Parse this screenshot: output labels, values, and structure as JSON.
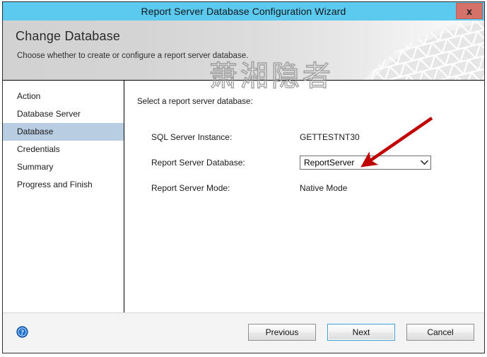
{
  "window": {
    "title": "Report Server Database Configuration Wizard",
    "close_label": "x",
    "close_icon": "close-icon"
  },
  "banner": {
    "heading": "Change Database",
    "subheading": "Choose whether to create or configure a report server database."
  },
  "watermark": {
    "text": "萧湘隐者"
  },
  "sidebar": {
    "items": [
      {
        "label": "Action",
        "selected": false
      },
      {
        "label": "Database Server",
        "selected": false
      },
      {
        "label": "Database",
        "selected": true
      },
      {
        "label": "Credentials",
        "selected": false
      },
      {
        "label": "Summary",
        "selected": false
      },
      {
        "label": "Progress and Finish",
        "selected": false
      }
    ]
  },
  "content": {
    "intro": "Select a report server database:",
    "fields": [
      {
        "label": "SQL Server Instance:",
        "value": "GETTESTNT30",
        "type": "text"
      },
      {
        "label": "Report Server Database:",
        "value": "ReportServer",
        "type": "combo"
      },
      {
        "label": "Report Server Mode:",
        "value": "Native Mode",
        "type": "text"
      }
    ],
    "combo_arrow_icon": "chevron-down-icon"
  },
  "footer": {
    "help_icon": "help-icon",
    "buttons": [
      {
        "label": "Previous",
        "default": false
      },
      {
        "label": "Next",
        "default": true
      },
      {
        "label": "Cancel",
        "default": false
      }
    ]
  },
  "annotation": {
    "arrow_color": "#c00000",
    "arrow_icon": "red-arrow-annotation"
  },
  "colors": {
    "titlebar": "#5cc9ef",
    "close_button": "#d4726a",
    "nav_selected": "#b9cde2",
    "accent": "#3f9fd0"
  }
}
